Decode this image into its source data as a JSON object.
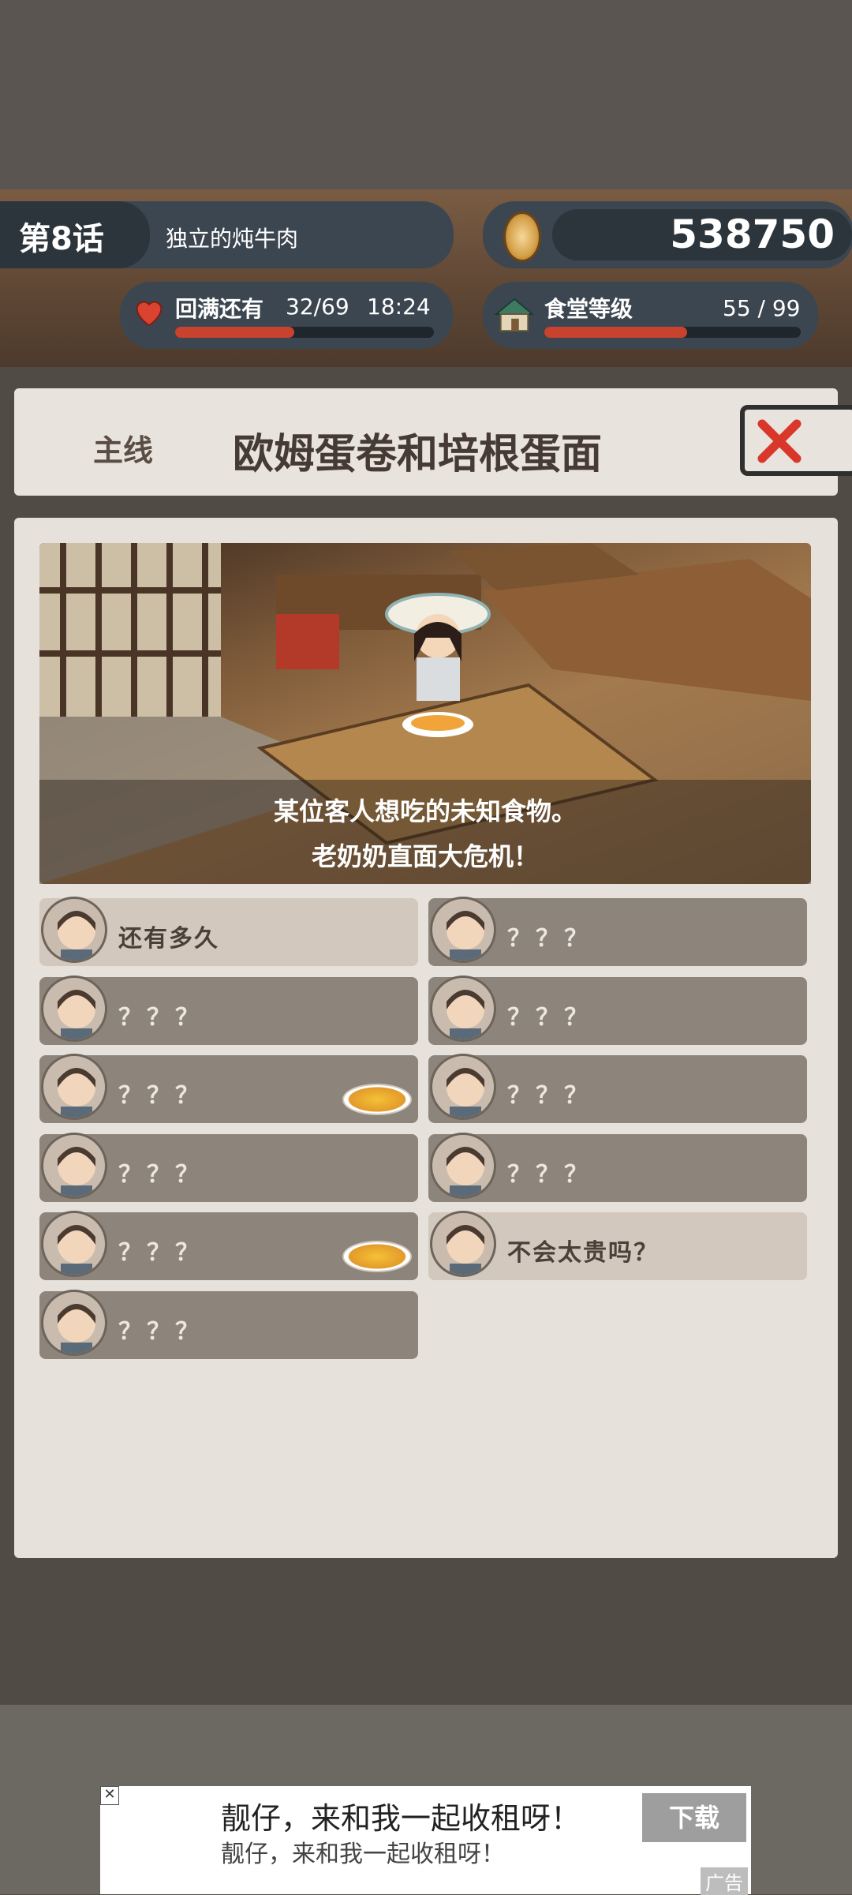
{
  "hud": {
    "chapter_number": "第8话",
    "chapter_title": "独立的炖牛肉",
    "coins": "538750",
    "stamina_label": "回满还有",
    "stamina_count": "32/69",
    "stamina_timer": "18:24",
    "stamina_fraction": 0.46,
    "level_label": "食堂等级",
    "level_count": "55 / 99",
    "level_fraction": 0.556
  },
  "header": {
    "tab": "主线",
    "title": "欧姆蛋卷和培根蛋面"
  },
  "scene": {
    "caption_line1": "某位客人想吃的未知食物。",
    "caption_line2": "老奶奶直面大危机！"
  },
  "dialogues": {
    "left": [
      {
        "label": "还有多久",
        "active": true,
        "avatar": "grandma-avatar",
        "dish": false
      },
      {
        "label": "？？？",
        "active": false,
        "avatar": "girl-avatar",
        "dish": false
      },
      {
        "label": "？？？",
        "active": false,
        "avatar": "sunglasses-man-avatar",
        "dish": true
      },
      {
        "label": "？？？",
        "active": false,
        "avatar": "hat-girl-avatar",
        "dish": false
      },
      {
        "label": "？？？",
        "active": false,
        "avatar": "hat-girl-avatar",
        "dish": true
      },
      {
        "label": "？？？",
        "active": false,
        "avatar": "grandma-avatar",
        "dish": false
      }
    ],
    "right": [
      {
        "label": "？？？",
        "active": false,
        "avatar": "boy-avatar",
        "dish": false
      },
      {
        "label": "？？？",
        "active": false,
        "avatar": "sunglasses-man-avatar",
        "dish": false
      },
      {
        "label": "？？？",
        "active": false,
        "avatar": "officer-avatar",
        "dish": false
      },
      {
        "label": "？？？",
        "active": false,
        "avatar": "girl-avatar",
        "dish": false
      },
      {
        "label": "不会太贵吗？",
        "active": true,
        "avatar": "man-avatar",
        "dish": false
      }
    ]
  },
  "ad": {
    "title": "靓仔，来和我一起收租呀！",
    "subtitle": "靓仔，来和我一起收租呀！",
    "download": "下载",
    "tag": "广告",
    "close": "✕"
  }
}
